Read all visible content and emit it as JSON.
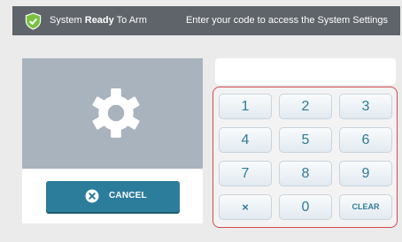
{
  "header": {
    "status_prefix": "System",
    "status_bold": "Ready",
    "status_suffix": "To Arm",
    "hint": "Enter your code to access the System Settings",
    "shield_icon": "shield-check-icon"
  },
  "settings_panel": {
    "icon": "gear-icon"
  },
  "cancel": {
    "label": "CANCEL",
    "icon": "close-circle-icon"
  },
  "code_field": {
    "value": ""
  },
  "keypad": {
    "rows": [
      [
        "1",
        "2",
        "3"
      ],
      [
        "4",
        "5",
        "6"
      ],
      [
        "7",
        "8",
        "9"
      ],
      [
        "×",
        "0",
        "CLEAR"
      ]
    ]
  },
  "colors": {
    "accent": "#2c7c9c",
    "header_bg": "#5e6469",
    "settings_bg": "#a9b3be",
    "keypad_border": "#d24a4a",
    "shield": "#7ac143"
  }
}
